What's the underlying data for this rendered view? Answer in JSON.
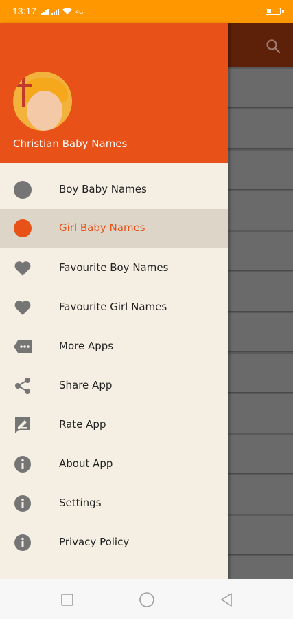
{
  "status_bar": {
    "time": "13:17",
    "network_label": "4G",
    "background_color": "#ff9800"
  },
  "drawer": {
    "app_name": "Christian Baby Names",
    "header_color": "#e85218",
    "avatar_icon": "baby-avatar-icon",
    "items": [
      {
        "label": "Boy Baby Names",
        "icon": "circle-grey-icon",
        "active": false
      },
      {
        "label": "Girl Baby Names",
        "icon": "circle-orange-icon",
        "active": true
      },
      {
        "label": "Favourite Boy Names",
        "icon": "heart-icon",
        "active": false
      },
      {
        "label": "Favourite Girl Names",
        "icon": "heart-icon",
        "active": false
      },
      {
        "label": "More Apps",
        "icon": "more-apps-icon",
        "active": false
      },
      {
        "label": "Share App",
        "icon": "share-icon",
        "active": false
      },
      {
        "label": "Rate App",
        "icon": "rate-icon",
        "active": false
      },
      {
        "label": "About App",
        "icon": "info-icon",
        "active": false
      },
      {
        "label": "Settings",
        "icon": "info-icon",
        "active": false
      },
      {
        "label": "Privacy Policy",
        "icon": "info-icon",
        "active": false
      }
    ]
  },
  "background_app": {
    "toolbar_icon": "search-icon"
  },
  "nav_bar": {
    "buttons": [
      "recent-apps-icon",
      "home-icon",
      "back-icon"
    ]
  }
}
